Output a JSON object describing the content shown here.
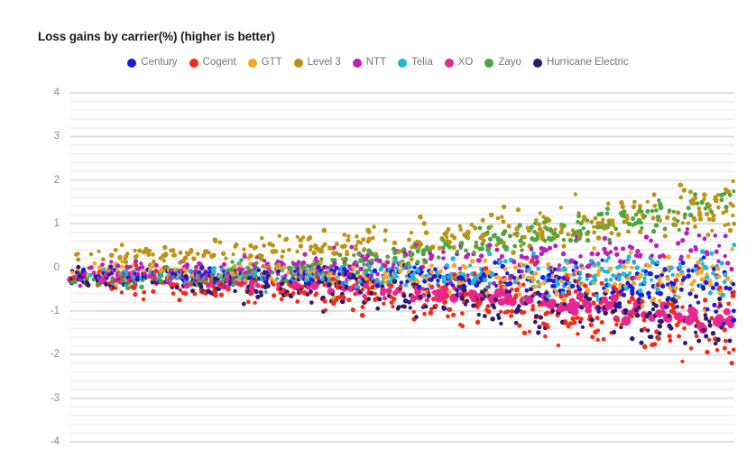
{
  "chart": {
    "title": "Loss gains by carrier(%) (higher is better)",
    "type": "scatter"
  },
  "legend": {
    "position": "top-center",
    "items": [
      {
        "label": "Century",
        "color": "#1a1ae0"
      },
      {
        "label": "Cogent",
        "color": "#f42b12"
      },
      {
        "label": "GTT",
        "color": "#f5a623"
      },
      {
        "label": "Level 3",
        "color": "#bd9312"
      },
      {
        "label": "NTT",
        "color": "#bb1fbb"
      },
      {
        "label": "Telia",
        "color": "#1eb8dd"
      },
      {
        "label": "XO",
        "color": "#e8268f"
      },
      {
        "label": "Zayo",
        "color": "#4ba63f"
      },
      {
        "label": "Hurricane Electric",
        "color": "#2b1a6e"
      }
    ]
  },
  "y_axis": {
    "ticks": [
      "4",
      "3",
      "2",
      "1",
      "0",
      "-1",
      "-2",
      "-3",
      "-4"
    ],
    "tick_values": [
      4,
      3,
      2,
      1,
      0,
      -1,
      -2,
      -3,
      -4
    ],
    "min": -4,
    "max": 4,
    "minor_divisions": 5,
    "label_color": "#8a8a8a"
  },
  "x_axis": {
    "ticks": [],
    "label": ""
  },
  "chart_data": {
    "type": "scatter",
    "title": "Loss gains by carrier(%) (higher is better)",
    "xlabel": "",
    "ylabel": "",
    "ylim": [
      -4,
      4
    ],
    "xlim": [
      0,
      1
    ],
    "grid": true,
    "legend_position": "top-center",
    "y_ticks": [
      4,
      3,
      2,
      1,
      0,
      -1,
      -2,
      -3,
      -4
    ],
    "notes": "Dense scatter of per-measurement loss gain percentages for nine transit carriers; points fan out with increasing x, most mass between -1 and +1, widening to roughly -3 to +2.5 at the right edge.",
    "series": [
      {
        "name": "Century",
        "color": "#1a1ae0",
        "n": 330,
        "band": {
          "center_start": -0.15,
          "center_end": -0.45,
          "spread_start": 0.18,
          "spread_end": 0.85
        },
        "description": "Blue band drifting slightly below zero, scattering wider at right with a few points near +1."
      },
      {
        "name": "Cogent",
        "color": "#f42b12",
        "n": 360,
        "band": {
          "center_start": -0.35,
          "center_end": -1.25,
          "spread_start": 0.45,
          "spread_end": 1.35
        },
        "description": "Red, widest vertical spread; trails down to about -3 at the far right and some points near +1.6."
      },
      {
        "name": "GTT",
        "color": "#f5a623",
        "n": 300,
        "band": {
          "center_start": -0.1,
          "center_end": -0.3,
          "spread_start": 0.25,
          "spread_end": 0.8
        },
        "description": "Orange band just below zero, forms a tight horizontal bar near -0.35 at the right."
      },
      {
        "name": "Level 3",
        "color": "#bd9312",
        "n": 340,
        "band": {
          "center_start": 0.25,
          "center_end": 1.35,
          "spread_start": 0.3,
          "spread_end": 0.75
        },
        "description": "Dark gold, trending upward; reaches about +2.2 at the right edge."
      },
      {
        "name": "NTT",
        "color": "#bb1fbb",
        "n": 280,
        "band": {
          "center_start": -0.1,
          "center_end": 0.35,
          "spread_start": 0.3,
          "spread_end": 0.7
        },
        "description": "Purple, dense near zero at the left, drifting up to roughly +1.3."
      },
      {
        "name": "Telia",
        "color": "#1eb8dd",
        "n": 300,
        "band": {
          "center_start": -0.2,
          "center_end": -0.15,
          "spread_start": 0.2,
          "spread_end": 0.75
        },
        "description": "Cyan, tight band near -0.2 with an upward tail to about +1 at the right."
      },
      {
        "name": "XO",
        "color": "#e8268f",
        "n": 150,
        "band": {
          "center_start": -0.25,
          "center_end": -1.25,
          "spread_start": 0.15,
          "spread_end": 0.3
        },
        "description": "Pink, clumped markers; drops to about -1.3 clusters at the right."
      },
      {
        "name": "Zayo",
        "color": "#4ba63f",
        "n": 300,
        "band": {
          "center_start": -0.35,
          "center_end": 1.55,
          "spread_start": 0.25,
          "spread_end": 0.55
        },
        "description": "Green, rising strongly on the right to about +2.4, the highest points in the plot."
      },
      {
        "name": "Hurricane Electric",
        "color": "#2b1a6e",
        "n": 290,
        "band": {
          "center_start": -0.3,
          "center_end": -1.35,
          "spread_start": 0.3,
          "spread_end": 0.85
        },
        "description": "Dark navy, declining to about -2.3 at the right with a cluster near -1.3."
      }
    ]
  }
}
